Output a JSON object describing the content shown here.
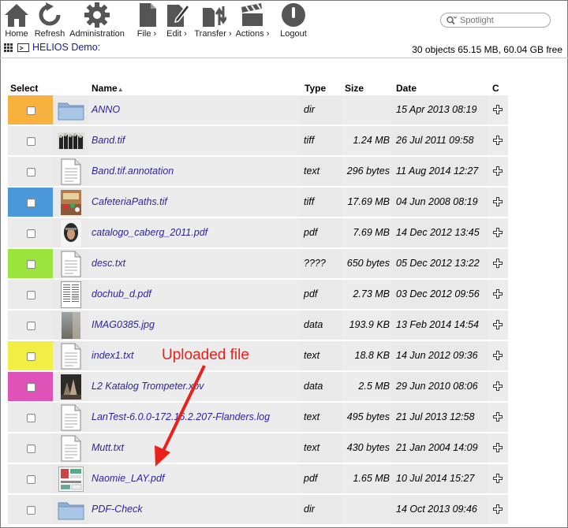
{
  "toolbar": {
    "items": [
      {
        "label": "Home",
        "icon": "home-icon"
      },
      {
        "label": "Refresh",
        "icon": "refresh-icon"
      },
      {
        "label": "Administration",
        "icon": "gear-icon"
      },
      {
        "label": "File ›",
        "icon": "file-icon"
      },
      {
        "label": "Edit ›",
        "icon": "edit-icon"
      },
      {
        "label": "Transfer ›",
        "icon": "transfer-icon"
      },
      {
        "label": "Actions ›",
        "icon": "clapper-icon"
      },
      {
        "label": "Logout",
        "icon": "power-icon"
      }
    ],
    "search_placeholder": "Spotlight"
  },
  "path": {
    "label": "HELIOS Demo:",
    "summary": "30 objects 65.15 MB, 60.04 GB free"
  },
  "table": {
    "headers": {
      "select": "Select",
      "name": "Name",
      "type": "Type",
      "size": "Size",
      "date": "Date",
      "c": "C"
    },
    "rows": [
      {
        "name": "ANNO",
        "type": "dir",
        "size": "",
        "date": "15 Apr 2013 08:19",
        "label_color": "#f7b13f",
        "thumb": "folder-icon"
      },
      {
        "name": "Band.tif",
        "type": "tiff",
        "size": "1.24 MB",
        "date": "26 Jul 2011 09:58",
        "label_color": "",
        "thumb": "band-photo-thumbnail"
      },
      {
        "name": "Band.tif.annotation",
        "type": "text",
        "size": "296 bytes",
        "date": "11 Aug 2014 12:27",
        "label_color": "",
        "thumb": "document-icon"
      },
      {
        "name": "CafeteriaPaths.tif",
        "type": "tiff",
        "size": "17.69 MB",
        "date": "04 Jun 2008 08:19",
        "label_color": "#4c97d9",
        "thumb": "cafeteria-photo-thumbnail"
      },
      {
        "name": "catalogo_caberg_2011.pdf",
        "type": "pdf",
        "size": "7.69 MB",
        "date": "14 Dec 2012 13:45",
        "label_color": "",
        "thumb": "catalog-cover-thumbnail"
      },
      {
        "name": "desc.txt",
        "type": "????",
        "size": "650 bytes",
        "date": "05 Dec 2012 13:22",
        "label_color": "#9be43e",
        "thumb": "document-icon"
      },
      {
        "name": "dochub_d.pdf",
        "type": "pdf",
        "size": "2.73 MB",
        "date": "03 Dec 2012 09:56",
        "label_color": "",
        "thumb": "page-thumbnail"
      },
      {
        "name": "IMAG0385.jpg",
        "type": "data",
        "size": "193.9 KB",
        "date": "13 Feb 2014 14:54",
        "label_color": "",
        "thumb": "photo-thumbnail"
      },
      {
        "name": "index1.txt",
        "type": "text",
        "size": "18.8 KB",
        "date": "14 Jun 2012 09:36",
        "label_color": "#f1ef45",
        "thumb": "document-icon"
      },
      {
        "name": "L2 Katalog Trompeter.xpv",
        "type": "data",
        "size": "2.5 MB",
        "date": "29 Jun 2010 08:06",
        "label_color": "#df52b7",
        "thumb": "night-photo-thumbnail"
      },
      {
        "name": "LanTest-6.0.0-172.16.2.207-Flanders.log",
        "type": "text",
        "size": "495 bytes",
        "date": "21 Jul 2013 12:58",
        "label_color": "",
        "thumb": "document-icon"
      },
      {
        "name": "Mutt.txt",
        "type": "text",
        "size": "430 bytes",
        "date": "21 Jan 2004 14:09",
        "label_color": "",
        "thumb": "document-icon"
      },
      {
        "name": "Naomie_LAY.pdf",
        "type": "pdf",
        "size": "1.65 MB",
        "date": "10 Jul 2014 15:27",
        "label_color": "",
        "thumb": "layout-page-thumbnail"
      },
      {
        "name": "PDF-Check",
        "type": "dir",
        "size": "",
        "date": "14 Oct 2013 09:46",
        "label_color": "",
        "thumb": "folder-icon"
      }
    ]
  },
  "annotation": {
    "text": "Uploaded file",
    "color": "#e8211b"
  }
}
